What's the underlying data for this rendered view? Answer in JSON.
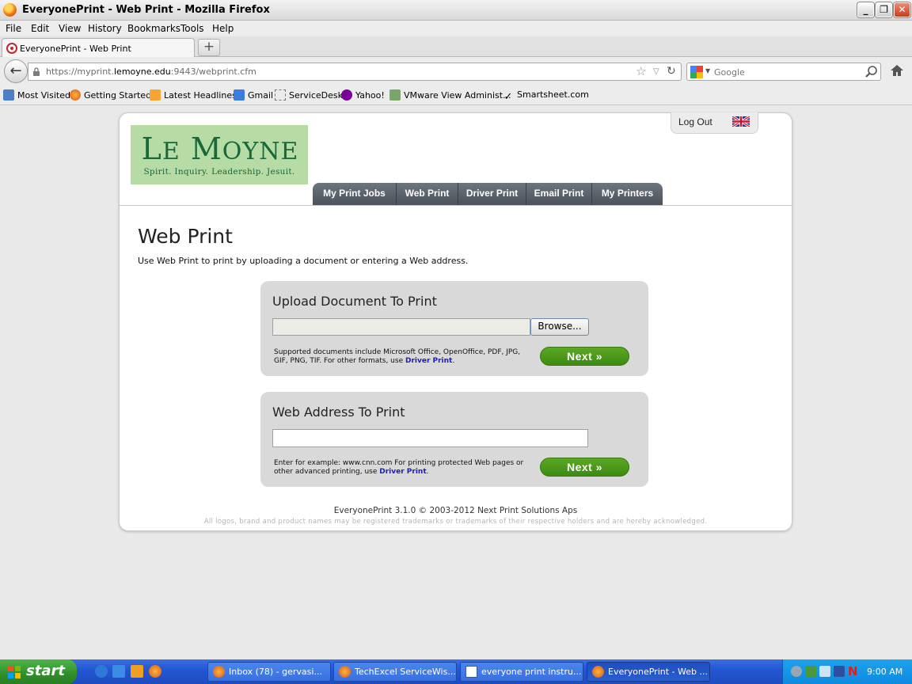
{
  "window": {
    "title": "EveryonePrint - Web Print - Mozilla Firefox"
  },
  "menu": [
    "File",
    "Edit",
    "View",
    "History",
    "Bookmarks",
    "Tools",
    "Help"
  ],
  "tab": {
    "label": "EveryonePrint - Web Print",
    "new_tab": "+"
  },
  "address": {
    "prefix": "https://myprint.",
    "domain": "lemoyne.edu",
    "suffix": ":9443/webprint.cfm"
  },
  "search": {
    "placeholder": "Google"
  },
  "bookmarks": [
    "Most Visited",
    "Getting Started",
    "Latest Headlines",
    "Gmail",
    "ServiceDesk",
    "Yahoo!",
    "VMware View Administ...",
    "Smartsheet.com"
  ],
  "site": {
    "logo_name_first": "L",
    "logo_name_first_small": "E",
    "logo_name_rest_big": "M",
    "logo_name_rest_small": "OYNE",
    "logo_motto": "Spirit. Inquiry. Leadership. Jesuit.",
    "logout": "Log Out",
    "nav": [
      "My Print Jobs",
      "Web Print",
      "Driver Print",
      "Email Print",
      "My Printers"
    ]
  },
  "main": {
    "title": "Web Print",
    "intro": "Use Web Print to print by uploading a document or entering a Web address.",
    "upload": {
      "title": "Upload Document To Print",
      "browse": "Browse...",
      "note": "Supported documents include Microsoft Office, OpenOffice, PDF, JPG, GIF, PNG, TIF. For other formats, use ",
      "note_link": "Driver Print",
      "note_end": ".",
      "next": "Next »"
    },
    "web": {
      "title": "Web Address To Print",
      "url_value": "",
      "note": "Enter for example: www.cnn.com For printing protected Web pages or other advanced printing, use ",
      "note_link": "Driver Print",
      "note_end": ".",
      "next": "Next »"
    },
    "footer": "EveryonePrint 3.1.0 © 2003-2012 Next Print Solutions Aps",
    "legal": "All logos, brand and product names may be registered trademarks or trademarks of their respective holders and are hereby acknowledged."
  },
  "taskbar": {
    "start": "start",
    "items": [
      "Inbox (78) - gervasi...",
      "TechExcel ServiceWis...",
      "everyone print instru...",
      "EveryonePrint - Web ..."
    ],
    "time": "9:00 AM"
  },
  "colors": {
    "nav_bg": "#4b5259",
    "next_green": "#3d8a14",
    "logo_green": "#17683a",
    "logo_bg": "#b6dba5",
    "link_blue": "#1d20b8"
  }
}
